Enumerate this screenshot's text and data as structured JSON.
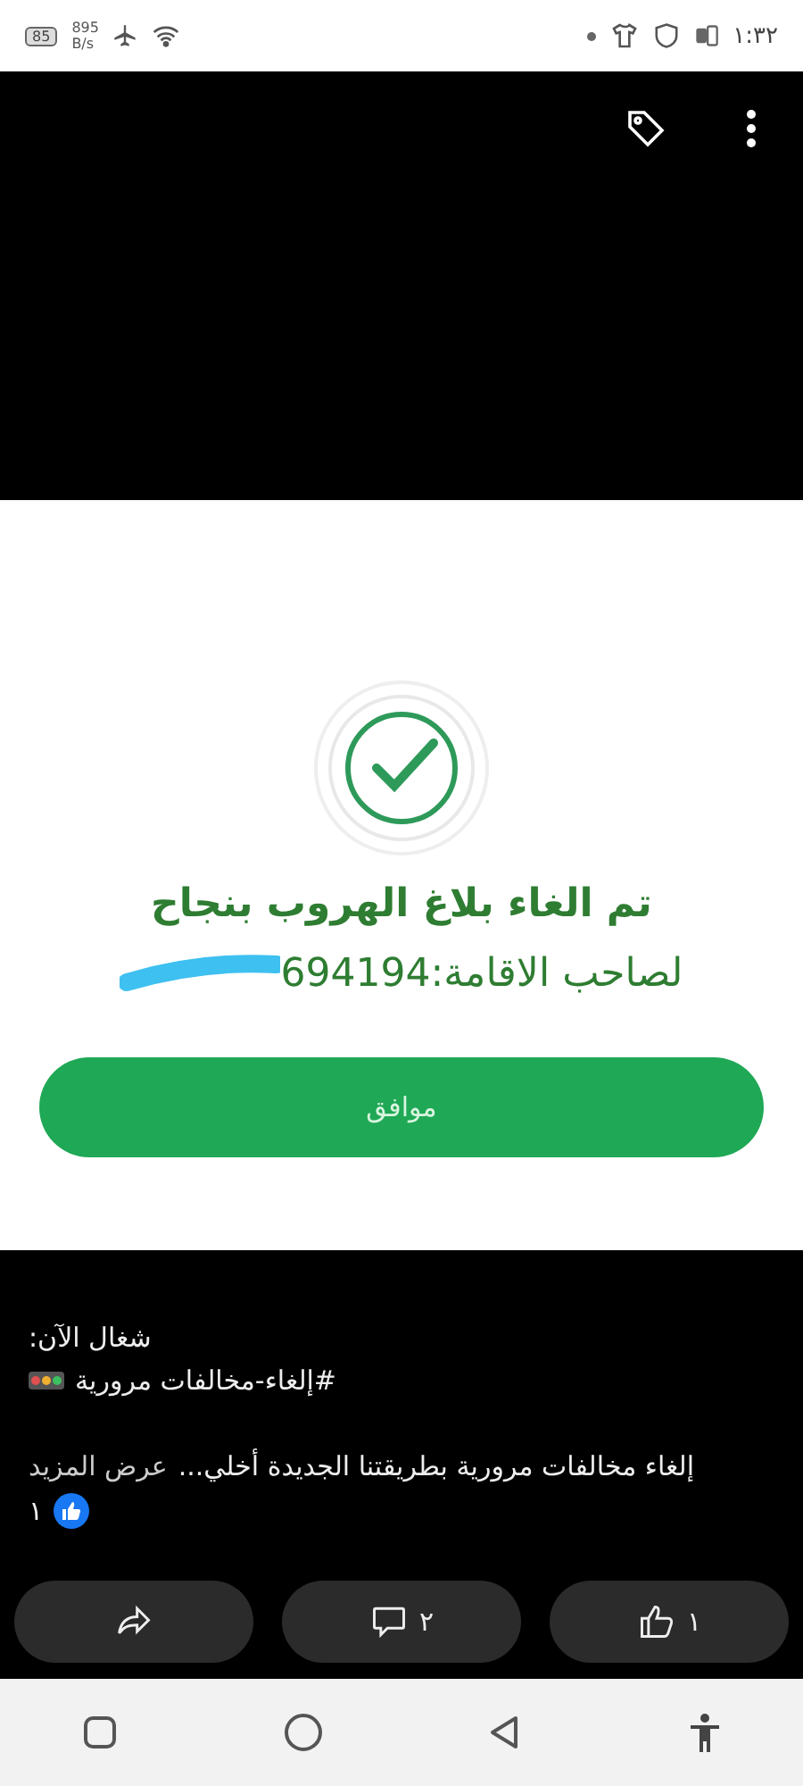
{
  "status_bar": {
    "battery": "85",
    "speed_value": "895",
    "speed_unit": "B/s",
    "time": "١:٣٢"
  },
  "shared_image": {
    "title": "تم الغاء بلاغ الهروب بنجاح",
    "subtitle": "لصاحب الاقامة:694194",
    "button": "موافق"
  },
  "post": {
    "line_1": "شغال الآن:",
    "hashtag": "#إلغاء-مخالفات مرورية",
    "body": "إلغاء مخالفات مرورية بطريقتنا الجديدة أخلي...",
    "see_more": "عرض المزيد",
    "reaction_count": "١"
  },
  "actions": [
    {
      "kind": "like",
      "count": "١"
    },
    {
      "kind": "comment",
      "count": "٢"
    },
    {
      "kind": "share"
    }
  ]
}
